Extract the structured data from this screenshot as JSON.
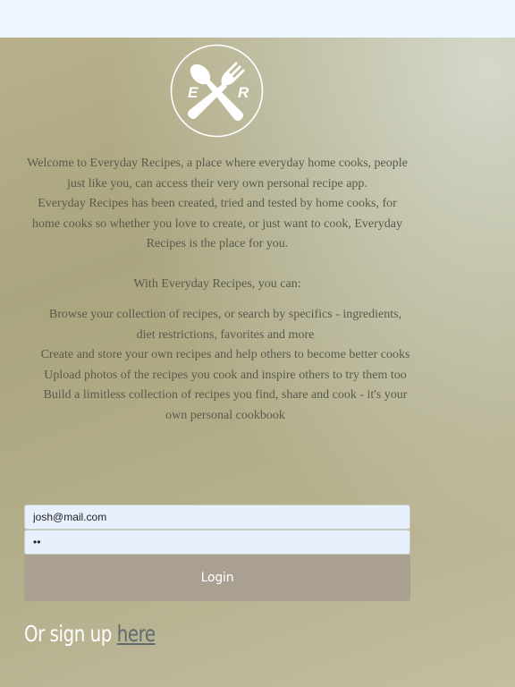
{
  "logo": {
    "letter_left": "E",
    "letter_right": "R",
    "icon": "spoon-fork-cross-icon"
  },
  "intro": {
    "welcome": "Welcome to Everyday Recipes, a place where everyday home cooks, people just like you, can access their very own personal recipe app.",
    "created": "Everyday Recipes has been created, tried and tested by home cooks, for home cooks so whether you love to create, or just want to cook, Everyday Recipes is the place for you.",
    "with_heading": "With Everyday Recipes, you can:"
  },
  "features": [
    "Browse your collection of recipes, or search by specifics - ingredients, diet restrictions, favorites and more",
    "Create and store your own recipes and help others to become better cooks",
    "Upload photos of the recipes you cook and inspire others to try them too",
    "Build a limitless collection of recipes you find, share and cook - it's your own personal cookbook"
  ],
  "login_form": {
    "email_value": "josh@mail.com",
    "password_value": "••",
    "login_label": "Login"
  },
  "signup": {
    "prefix": "Or sign up",
    "link_label": "here"
  },
  "colors": {
    "top_bar": "#eef6ff",
    "login_button": "#a9a092",
    "link": "#5f6b6d",
    "body_text": "#5a5a4c"
  }
}
